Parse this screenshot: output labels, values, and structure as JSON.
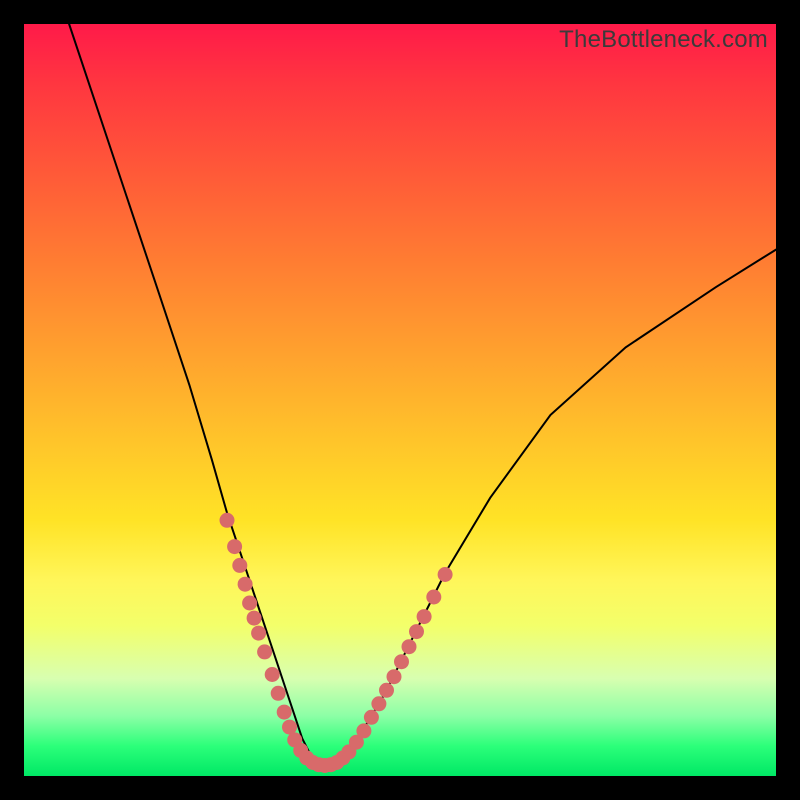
{
  "watermark": "TheBottleneck.com",
  "colors": {
    "curve": "#000000",
    "dot": "#d86a6a",
    "frame_bg": "#000000"
  },
  "chart_data": {
    "type": "line",
    "title": "",
    "xlabel": "",
    "ylabel": "",
    "xlim": [
      0,
      100
    ],
    "ylim": [
      0,
      100
    ],
    "series": [
      {
        "name": "bottleneck-curve",
        "x": [
          6,
          10,
          14,
          18,
          22,
          25,
          27,
          29,
          31,
          33,
          35,
          36,
          37,
          38,
          39.5,
          41,
          43,
          45,
          48,
          52,
          56,
          62,
          70,
          80,
          92,
          100
        ],
        "y": [
          100,
          88,
          76,
          64,
          52,
          42,
          35,
          29,
          23,
          17,
          11,
          8,
          5,
          3,
          1.5,
          1.5,
          3,
          6,
          11,
          19,
          27,
          37,
          48,
          57,
          65,
          70
        ]
      }
    ],
    "marker_clusters": [
      {
        "name": "left-branch-dots",
        "points": [
          [
            27.0,
            34.0
          ],
          [
            28.0,
            30.5
          ],
          [
            28.7,
            28.0
          ],
          [
            29.4,
            25.5
          ],
          [
            30.0,
            23.0
          ],
          [
            30.6,
            21.0
          ],
          [
            31.2,
            19.0
          ],
          [
            32.0,
            16.5
          ],
          [
            33.0,
            13.5
          ],
          [
            33.8,
            11.0
          ],
          [
            34.6,
            8.5
          ],
          [
            35.3,
            6.5
          ],
          [
            36.0,
            4.8
          ],
          [
            36.8,
            3.4
          ],
          [
            37.6,
            2.4
          ]
        ]
      },
      {
        "name": "trough-dots",
        "points": [
          [
            38.4,
            1.8
          ],
          [
            39.2,
            1.5
          ],
          [
            40.0,
            1.4
          ],
          [
            40.8,
            1.5
          ],
          [
            41.6,
            1.8
          ],
          [
            42.4,
            2.4
          ],
          [
            43.2,
            3.2
          ]
        ]
      },
      {
        "name": "right-branch-dots",
        "points": [
          [
            44.2,
            4.5
          ],
          [
            45.2,
            6.0
          ],
          [
            46.2,
            7.8
          ],
          [
            47.2,
            9.6
          ],
          [
            48.2,
            11.4
          ],
          [
            49.2,
            13.2
          ],
          [
            50.2,
            15.2
          ],
          [
            51.2,
            17.2
          ],
          [
            52.2,
            19.2
          ],
          [
            53.2,
            21.2
          ],
          [
            54.5,
            23.8
          ],
          [
            56.0,
            26.8
          ]
        ]
      }
    ]
  }
}
